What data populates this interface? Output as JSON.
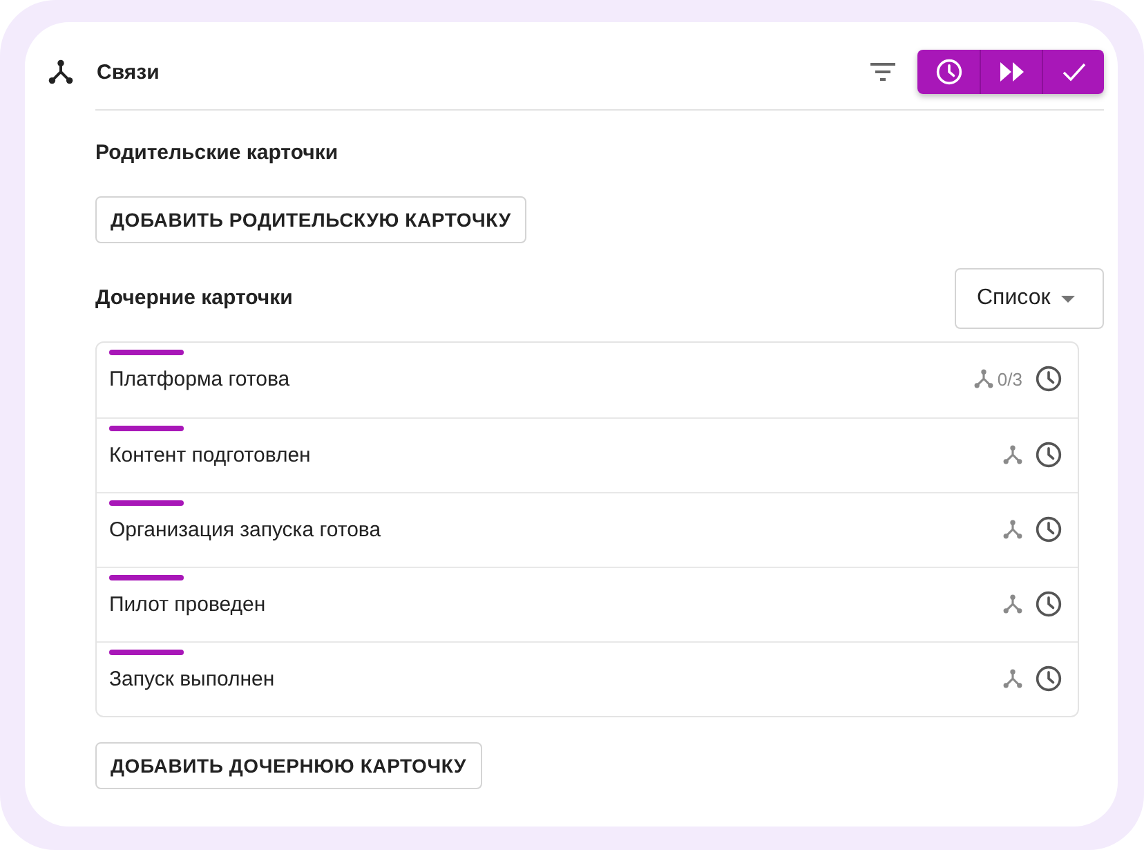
{
  "header": {
    "title": "Связи"
  },
  "parents": {
    "heading": "Родительские карточки",
    "add_button": "ДОБАВИТЬ РОДИТЕЛЬСКУЮ КАРТОЧКУ"
  },
  "children": {
    "heading": "Дочерние карточки",
    "view_select": {
      "value": "Список"
    },
    "cards": [
      {
        "title": "Платформа готова",
        "links_count": "0/3"
      },
      {
        "title": "Контент подготовлен"
      },
      {
        "title": "Организация запуска готова"
      },
      {
        "title": "Пилот проведен"
      },
      {
        "title": "Запуск выполнен"
      }
    ],
    "add_button": "ДОБАВИТЬ ДОЧЕРНЮЮ КАРТОЧКУ"
  }
}
